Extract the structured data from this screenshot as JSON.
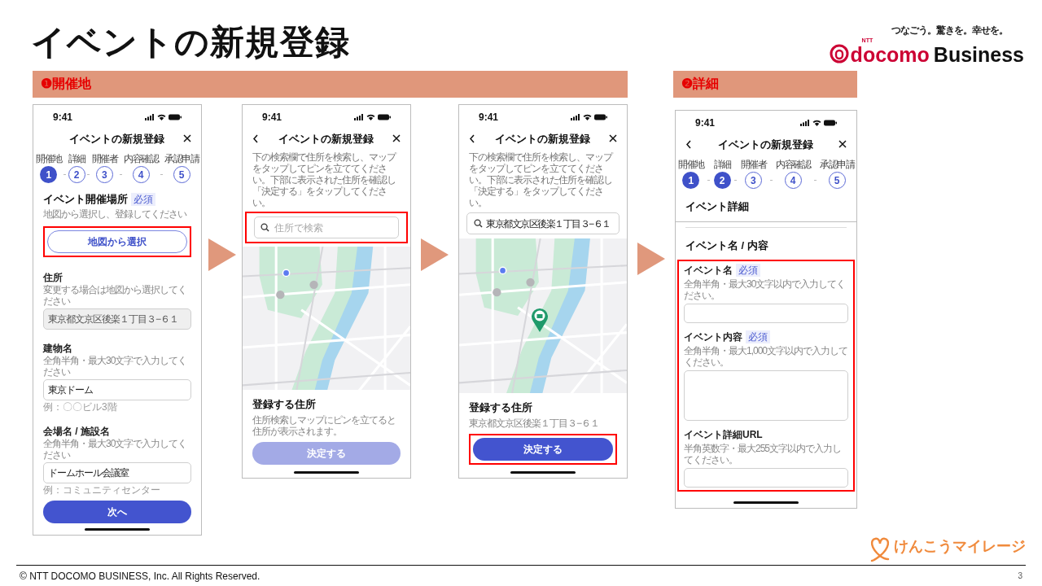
{
  "title": "イベントの新規登録",
  "logo": {
    "tagline": "つなごう。驚きを。幸せを。",
    "ntt": "NTT",
    "brand": "docomo",
    "brand_2": "Business"
  },
  "sections": [
    {
      "label": "❶開催地"
    },
    {
      "label": "❷詳細"
    }
  ],
  "screens": [
    {
      "time": "9:41",
      "title": "イベントの新規登録",
      "back": false,
      "blocks": [
        {
          "kind": "stepper",
          "steps": [
            {
              "label": "開催地",
              "number": "1",
              "done": true
            },
            {
              "label": "詳細",
              "number": "2",
              "done": false
            },
            {
              "label": "開催者",
              "number": "3",
              "done": false
            },
            {
              "label": "内容確認",
              "number": "4",
              "done": false
            },
            {
              "label": "承認申請",
              "number": "5",
              "done": false
            }
          ]
        },
        {
          "kind": "heading",
          "text": "イベント開催場所",
          "badge": "必須",
          "hint": "地図から選択し、登録してください"
        },
        {
          "kind": "outline_button",
          "text": "地図から選択",
          "highlighted": true
        },
        {
          "kind": "field",
          "label": "住所",
          "hint": "変更する場合は地図から選択してください",
          "value": "東京都文京区後楽１丁目３−６１",
          "disabled": true
        },
        {
          "kind": "field",
          "label": "建物名",
          "hint": "全角半角・最大30文字で入力してください",
          "value": "東京ドーム",
          "note": "例：〇〇ビル3階",
          "disabled": false
        },
        {
          "kind": "field",
          "label": "会場名 / 施設名",
          "hint": "全角半角・最大30文字で入力してください",
          "value": "ドームホール会議室",
          "note": "例：コミュニティセンター",
          "disabled": false
        },
        {
          "kind": "button",
          "text": "次へ",
          "disabled": false,
          "highlighted": false
        }
      ]
    },
    {
      "time": "9:41",
      "title": "イベントの新規登録",
      "back": true,
      "blocks": [
        {
          "kind": "intro",
          "text": "下の検索欄で住所を検索し、マップをタップしてピンを立ててください。下部に表示された住所を確認し「決定する」をタップしてください。"
        },
        {
          "kind": "search",
          "placeholder": "住所で検索",
          "highlighted": true
        },
        {
          "kind": "map",
          "pin": false
        },
        {
          "kind": "result",
          "heading": "登録する住所",
          "text": "住所検索しマップにピンを立てると住所が表示されます。"
        },
        {
          "kind": "button",
          "text": "決定する",
          "disabled": true,
          "highlighted": false
        }
      ]
    },
    {
      "time": "9:41",
      "title": "イベントの新規登録",
      "back": true,
      "blocks": [
        {
          "kind": "intro",
          "text": "下の検索欄で住所を検索し、マップをタップしてピンを立ててください。下部に表示された住所を確認し「決定する」をタップしてください。"
        },
        {
          "kind": "search",
          "value": "東京都文京区後楽１丁目３−６１",
          "highlighted": false
        },
        {
          "kind": "map",
          "pin": true
        },
        {
          "kind": "result",
          "heading": "登録する住所",
          "text": "東京都文京区後楽１丁目３−６１"
        },
        {
          "kind": "button",
          "text": "決定する",
          "disabled": false,
          "highlighted": true
        }
      ]
    },
    {
      "time": "9:41",
      "title": "イベントの新規登録",
      "back": true,
      "blocks": [
        {
          "kind": "stepper",
          "steps": [
            {
              "label": "開催地",
              "number": "1",
              "done": true
            },
            {
              "label": "詳細",
              "number": "2",
              "done": true
            },
            {
              "label": "開催者",
              "number": "3",
              "done": false
            },
            {
              "label": "内容確認",
              "number": "4",
              "done": false
            },
            {
              "label": "承認申請",
              "number": "5",
              "done": false
            }
          ]
        },
        {
          "kind": "section",
          "text": "イベント詳細"
        },
        {
          "kind": "subheading",
          "text": "イベント名 / 内容"
        },
        {
          "kind": "group",
          "highlighted": true,
          "fields": [
            {
              "label": "イベント名",
              "badge": "必須",
              "hint": "全角半角・最大30文字以内で入力してください。",
              "multiline": false
            },
            {
              "label": "イベント内容",
              "badge": "必須",
              "hint": "全角半角・最大1,000文字以内で入力してください。",
              "multiline": true
            },
            {
              "label": "イベント詳細URL",
              "hint": "半角英数字・最大255文字以内で入力してください。",
              "multiline": false
            }
          ]
        }
      ]
    }
  ],
  "footer_logo": "けんこうマイレージ",
  "copyright": "© NTT DOCOMO BUSINESS, Inc. All Rights Reserved.",
  "page_number": "3"
}
